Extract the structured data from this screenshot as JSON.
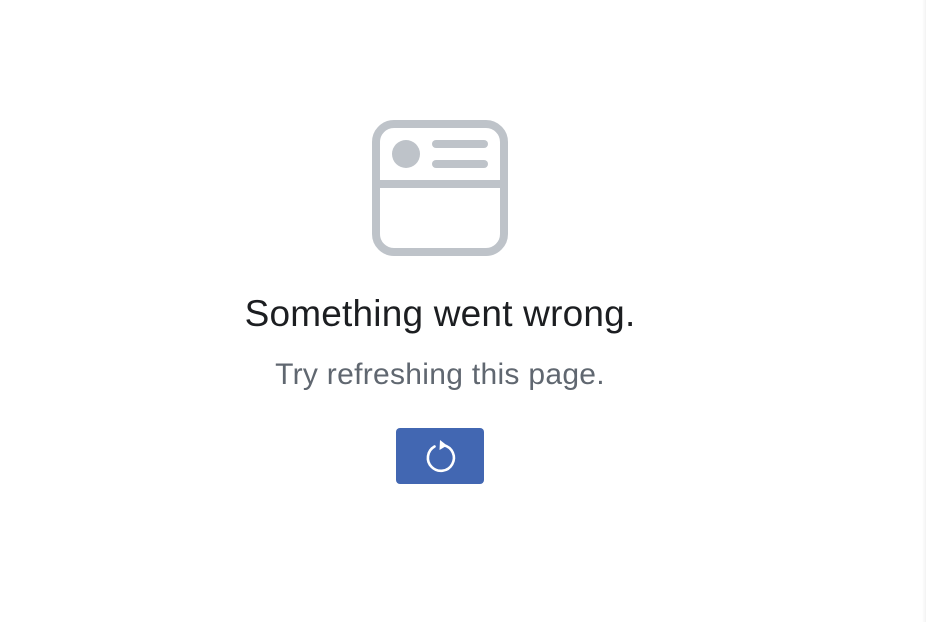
{
  "error": {
    "title": "Something went wrong.",
    "message": "Try refreshing this page.",
    "illustration_icon": "browser-window-icon",
    "refresh_icon": "refresh-icon"
  },
  "colors": {
    "illustration": "#bec3c9",
    "title_text": "#1c1e21",
    "message_text": "#606770",
    "button_background": "#4267b2",
    "button_icon": "#ffffff"
  }
}
